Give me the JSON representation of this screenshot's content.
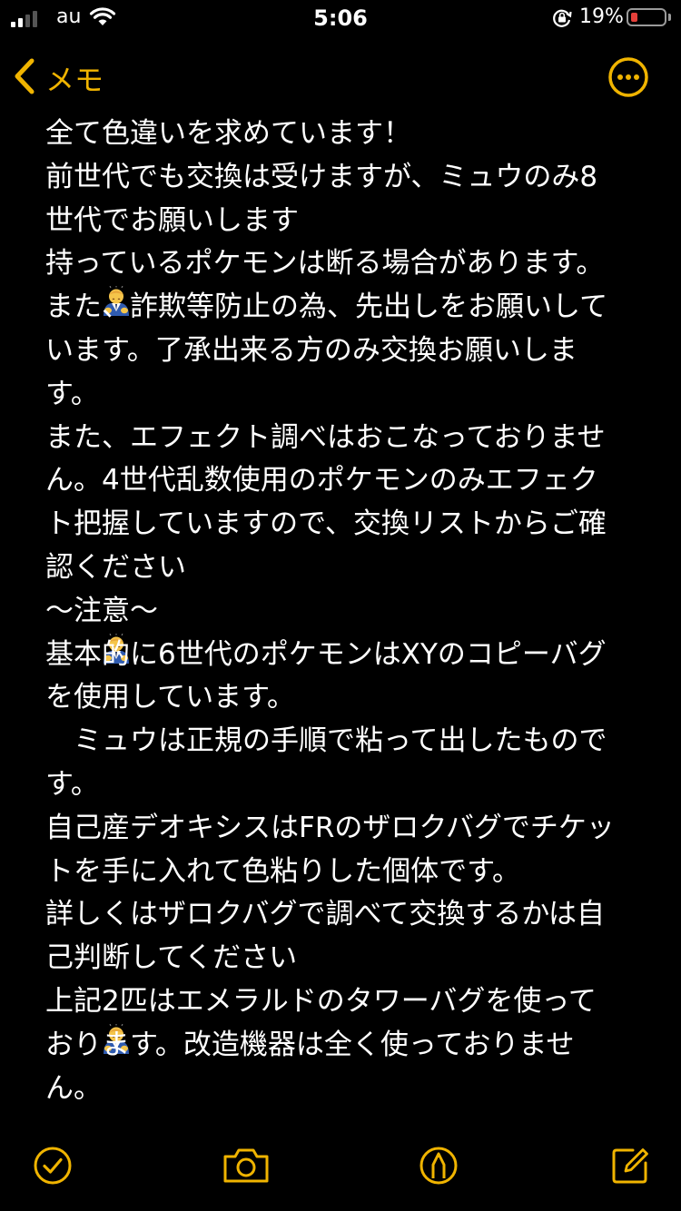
{
  "status_bar": {
    "carrier": "au",
    "time": "5:06",
    "battery_percent": "19%",
    "battery_level": 0.19,
    "battery_color": "#e5403a",
    "signal_bars": 4,
    "signal_bars_active": 2
  },
  "nav": {
    "back_label": "メモ",
    "back_icon": "chevron-left-icon",
    "more_icon": "more-options-icon",
    "accent_color": "#f0b400"
  },
  "note": {
    "lines": [
      "全て色違いを求めています！",
      "前世代でも交換は受けますが、ミュウのみ8",
      "世代でお願いします",
      "持っているポケモンは断る場合があります。",
      "また、詐欺等防止の為、先出しをお願いして",
      "います。了承出来る方のみ交換お願いしま",
      "す。",
      "また、エフェクト調べはおこなっておりませ",
      "ん。4世代乱数使用のポケモンのみエフェク",
      "ト把握していますので、交換リストからご確",
      "認ください",
      "〜注意〜",
      "基本的に6世代のポケモンはXYのコピーバグ",
      "を使用しています。",
      "　ミュウは正規の手順で粘って出したもので",
      "す。",
      "自己産デオキシスはFRのザロクバグでチケッ",
      "トを手に入れて色粘りした個体です。",
      "詳しくはザロクバグで調べて交換するかは自",
      "己判断してください",
      "上記2匹はエメラルドのタワーバグを使って",
      "おります。改造機器は全く使っておりませ",
      "ん。"
    ],
    "emoji_after_lines": [
      2,
      10,
      19
    ],
    "emoji_icon": "bowing-person-emoji"
  },
  "toolbar": {
    "items": [
      "checklist-icon",
      "camera-icon",
      "markup-pen-icon",
      "compose-icon"
    ]
  }
}
